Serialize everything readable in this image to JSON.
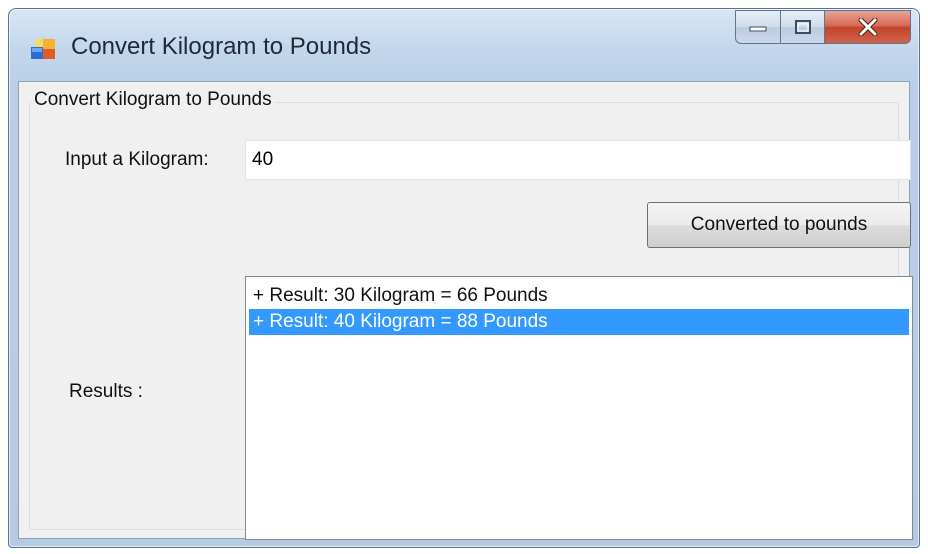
{
  "window": {
    "title": "Convert Kilogram to Pounds"
  },
  "caption": {
    "minimize_icon": "minimize-icon",
    "maximize_icon": "maximize-icon",
    "close_icon": "close-icon"
  },
  "group": {
    "legend": "Convert Kilogram to Pounds"
  },
  "form": {
    "input_label": "Input a Kilogram:",
    "input_value": "40",
    "convert_button": "Converted to pounds",
    "results_label": "Results :"
  },
  "results": {
    "items": [
      {
        "text": "+ Result: 30 Kilogram = 66 Pounds",
        "selected": false
      },
      {
        "text": "+ Result: 40 Kilogram = 88 Pounds",
        "selected": true
      }
    ]
  },
  "colors": {
    "selection": "#3399ff",
    "close_button": "#c2452c"
  }
}
